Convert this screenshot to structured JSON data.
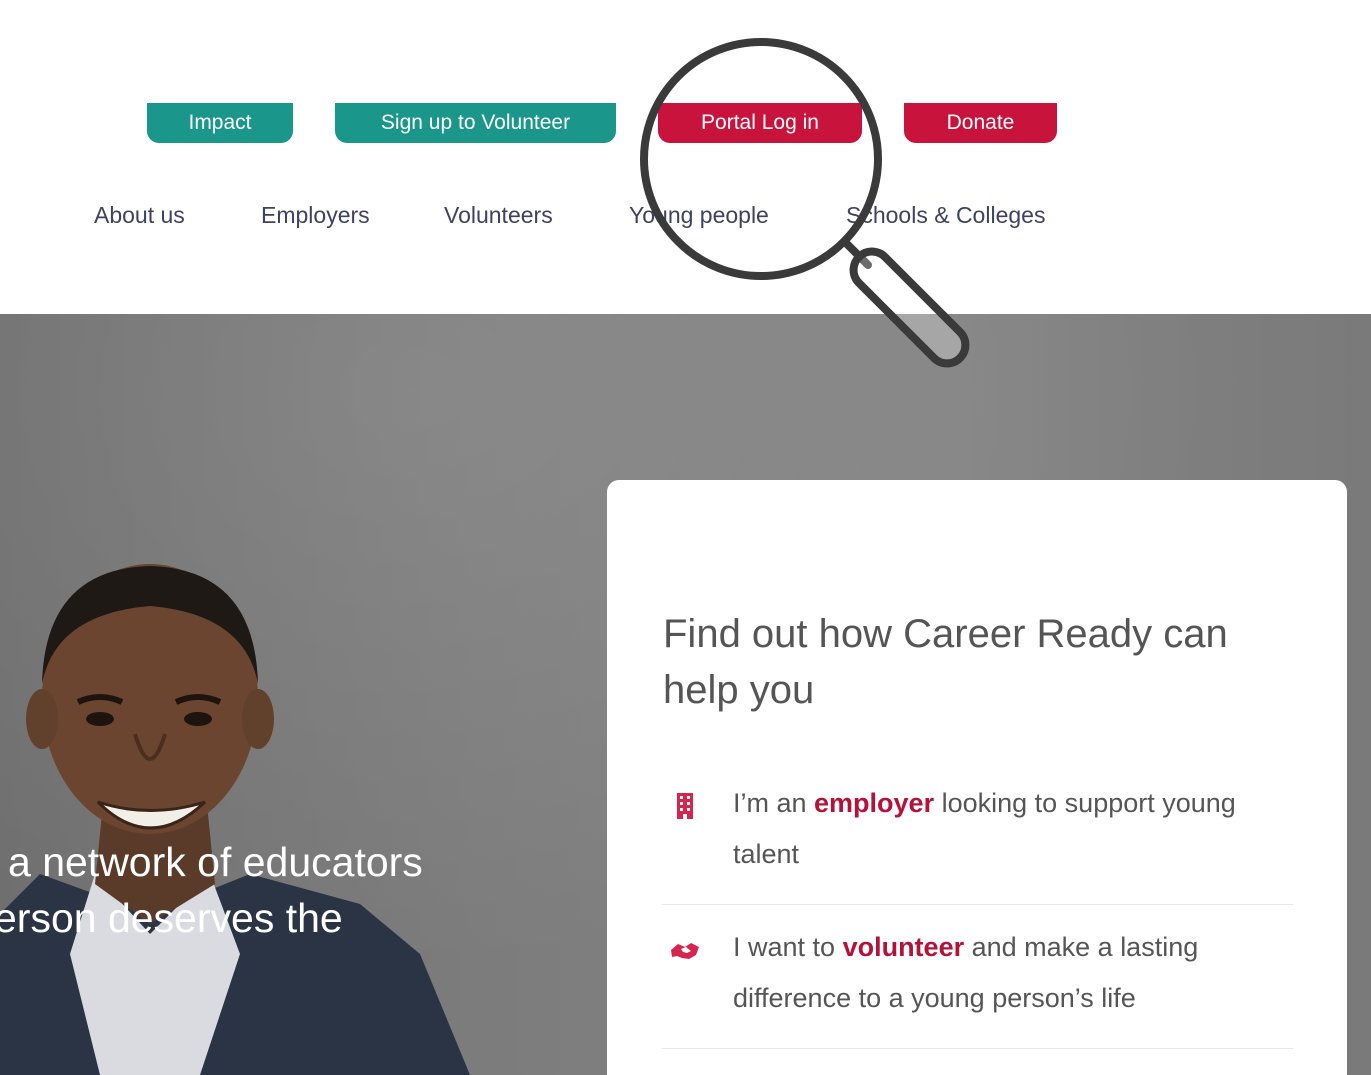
{
  "top_buttons": {
    "impact": "Impact",
    "volunteer": "Sign up to Volunteer",
    "portal": "Portal Log in",
    "donate": "Donate"
  },
  "nav": {
    "about": "About us",
    "employers": "Employers",
    "volunteers": "Volunteers",
    "young_people": "Young people",
    "schools": "Schools & Colleges"
  },
  "hero": {
    "line1": "a network of educators",
    "line2": "erson deserves the"
  },
  "card": {
    "title": "Find out how Career Ready can help you",
    "options": [
      {
        "icon": "building-icon",
        "prefix": "I’m an ",
        "highlight": "employer",
        "suffix": " looking to support young talent"
      },
      {
        "icon": "handshake-icon",
        "prefix": "I want to ",
        "highlight": "volunteer",
        "suffix": " and make a lasting difference to a young person’s life"
      }
    ]
  },
  "colors": {
    "teal": "#1a968a",
    "red": "#c8143c",
    "nav_text": "#3e4163",
    "highlight": "#b5123a"
  }
}
